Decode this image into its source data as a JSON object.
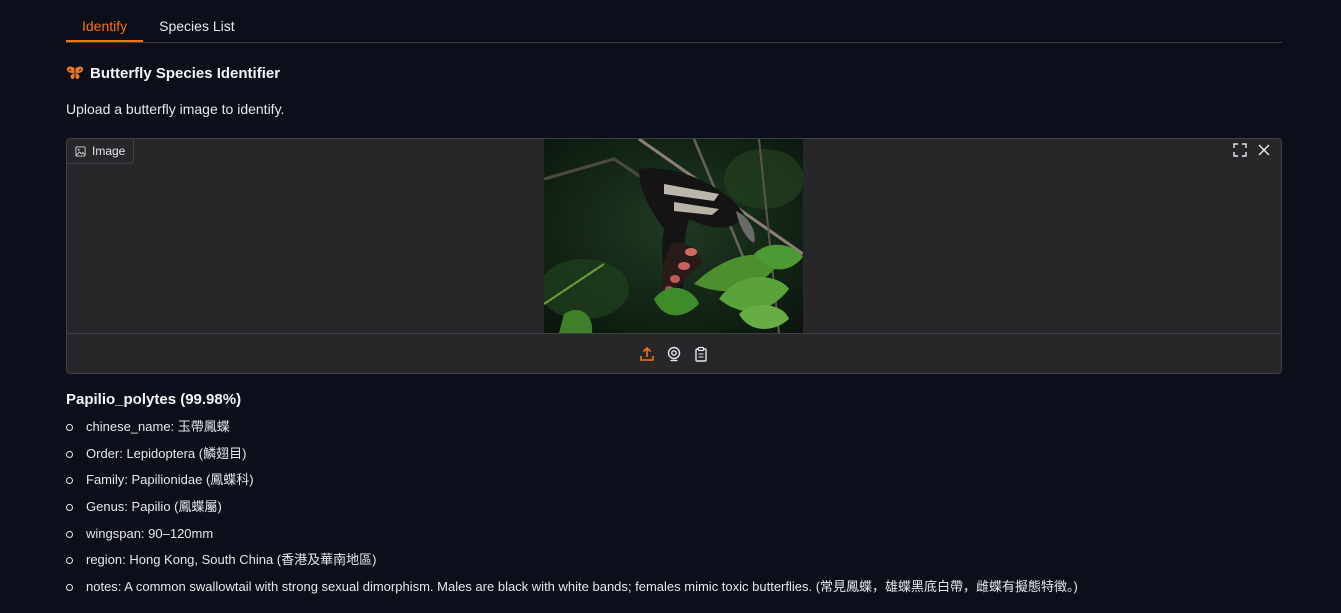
{
  "tabs": [
    {
      "label": "Identify",
      "active": true
    },
    {
      "label": "Species List",
      "active": false
    }
  ],
  "header": {
    "icon": "butterfly-emoji",
    "title": "Butterfly Species Identifier",
    "description": "Upload a butterfly image to identify."
  },
  "image_input": {
    "label": "Image",
    "buttons": [
      "fullscreen-icon",
      "close-icon"
    ],
    "sources": [
      "upload-icon",
      "webcam-icon",
      "clipboard-icon"
    ]
  },
  "result": {
    "title": "Papilio_polytes (99.98%)",
    "details": [
      "chinese_name: 玉帶鳳蝶",
      "Order: Lepidoptera (鱗翅目)",
      "Family: Papilionidae (鳳蝶科)",
      "Genus: Papilio (鳳蝶屬)",
      "wingspan: 90–120mm",
      "region: Hong Kong, South China (香港及華南地區)",
      "notes: A common swallowtail with strong sexual dimorphism. Males are black with white bands; females mimic toxic butterflies. (常見鳳蝶，雄蝶黑底白帶，雌蝶有擬態特徵。)"
    ]
  },
  "colors": {
    "accent": "#f97316",
    "background": "#0b0f19",
    "panel": "#27272a"
  }
}
